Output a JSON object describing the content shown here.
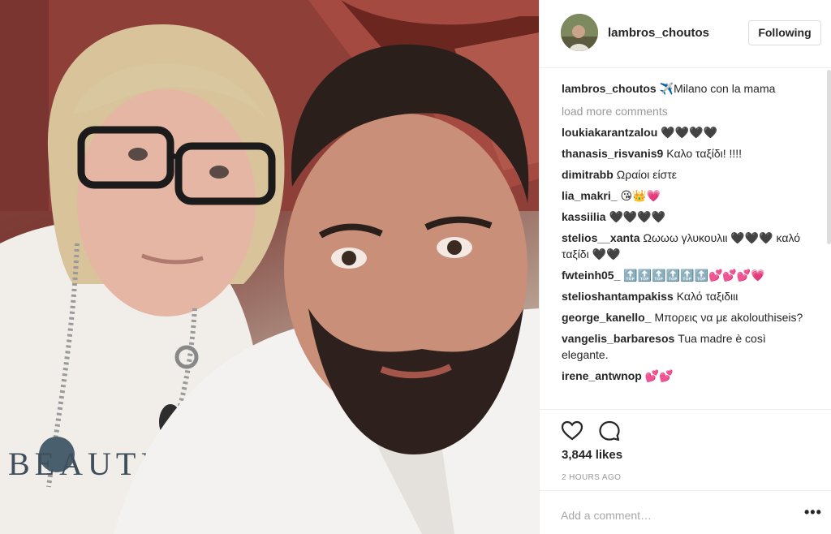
{
  "header": {
    "username": "lambros_choutos",
    "follow_label": "Following"
  },
  "caption": {
    "user": "lambros_choutos",
    "text": "✈️Milano con la mama"
  },
  "load_more": "load more comments",
  "comments": [
    {
      "user": "loukiakarantzalou",
      "text": "🖤🖤🖤🖤"
    },
    {
      "user": "thanasis_risvanis9",
      "text": "Καλο ταξίδι! !!!!"
    },
    {
      "user": "dimitrabb",
      "text": "Ωραίοι είστε"
    },
    {
      "user": "lia_makri_",
      "text": "😘👑💗"
    },
    {
      "user": "kassiilia",
      "text": "🖤🖤🖤🖤"
    },
    {
      "user": "stelios__xanta",
      "text": "Ωωωω γλυκουλιι 🖤🖤🖤 καλό ταξίδι 🖤🖤"
    },
    {
      "user": "fwteinh05_",
      "text": "🔝🔝🔝🔝🔝🔝💕💕💕💗"
    },
    {
      "user": "stelioshantampakiss",
      "text": "Καλό ταξιδιιι"
    },
    {
      "user": "george_kanello_",
      "text": "Μπορεις να με akolouthiseis?"
    },
    {
      "user": "vangelis_barbaresos",
      "text": "Tua madre è così elegante."
    },
    {
      "user": "irene_antwnop",
      "text": "💕💕"
    }
  ],
  "likes": "3,844 likes",
  "time": "2 HOURS AGO",
  "comment_input": {
    "placeholder": "Add a comment…"
  },
  "shirt_text": "BEAUTIFUL",
  "colors": {
    "border": "#efefef",
    "text": "#262626",
    "muted": "#999999"
  }
}
